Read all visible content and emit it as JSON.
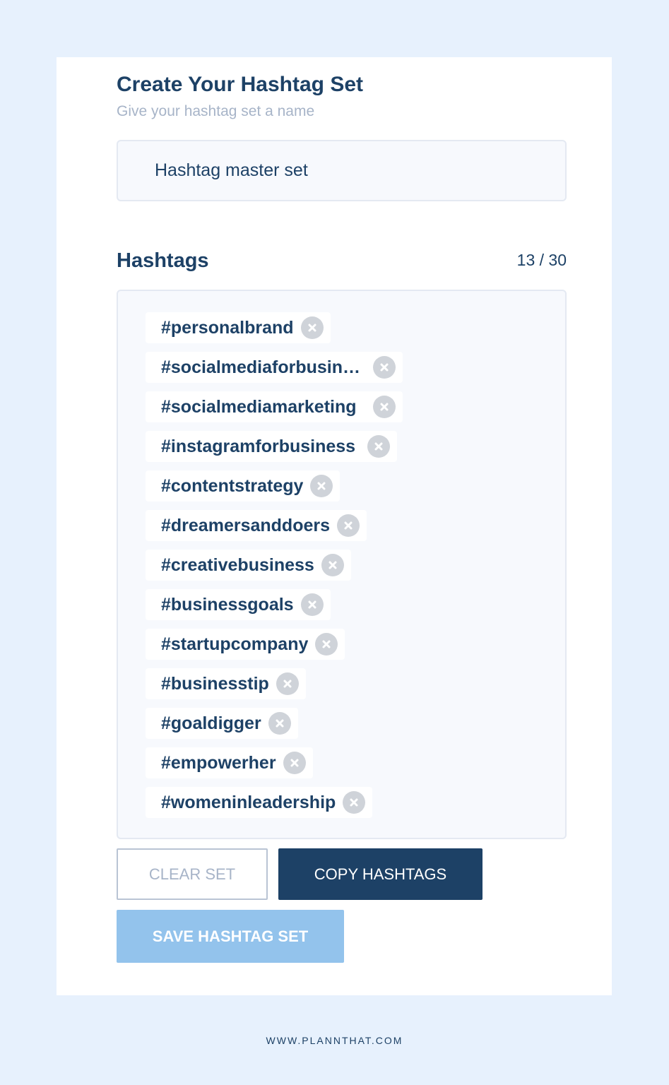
{
  "header": {
    "title": "Create Your Hashtag Set",
    "subtitle": "Give your hashtag set a name"
  },
  "name_input": {
    "value": "Hashtag master set"
  },
  "hashtags": {
    "section_title": "Hashtags",
    "counter": "13 / 30",
    "tags": [
      {
        "label": "#personalbrand"
      },
      {
        "label": "#socialmediaforbusiness"
      },
      {
        "label": "#socialmediamarketing"
      },
      {
        "label": "#instagramforbusiness"
      },
      {
        "label": "#contentstrategy"
      },
      {
        "label": "#dreamersanddoers"
      },
      {
        "label": "#creativebusiness"
      },
      {
        "label": "#businessgoals"
      },
      {
        "label": "#startupcompany"
      },
      {
        "label": "#businesstip"
      },
      {
        "label": "#goaldigger"
      },
      {
        "label": "#empowerher"
      },
      {
        "label": "#womeninleadership"
      }
    ]
  },
  "buttons": {
    "clear": "CLEAR SET",
    "copy": "COPY HASHTAGS",
    "save": "SAVE HASHTAG SET"
  },
  "footer": {
    "url": "WWW.PLANNTHAT.COM"
  },
  "colors": {
    "background": "#e7f1fd",
    "primary": "#1d4166",
    "save_button": "#93c3ec",
    "muted_text": "#a7b4c8",
    "remove_icon_bg": "#cfd3d9"
  },
  "icons": {
    "remove": "close-circle-icon"
  }
}
